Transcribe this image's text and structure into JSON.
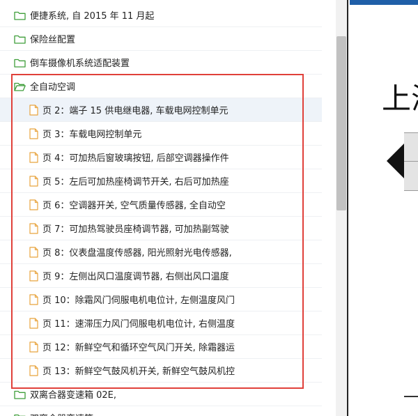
{
  "tree": {
    "rows": [
      {
        "type": "folder",
        "label": "便捷系统, 自 2015 年 11 月起"
      },
      {
        "type": "folder",
        "label": "保险丝配置"
      },
      {
        "type": "folder",
        "label": "倒车摄像机系统适配装置"
      },
      {
        "type": "folder",
        "label": "全自动空调",
        "open": true
      },
      {
        "type": "page",
        "label": "页 2：端子 15 供电继电器, 车载电网控制单元",
        "selected": true
      },
      {
        "type": "page",
        "label": "页 3：车载电网控制单元"
      },
      {
        "type": "page",
        "label": "页 4：可加热后窗玻璃按钮, 后部空调器操作件"
      },
      {
        "type": "page",
        "label": "页 5：左后可加热座椅调节开关, 右后可加热座"
      },
      {
        "type": "page",
        "label": "页 6：空调器开关, 空气质量传感器, 全自动空"
      },
      {
        "type": "page",
        "label": "页 7：可加热驾驶员座椅调节器, 可加热副驾驶"
      },
      {
        "type": "page",
        "label": "页 8：仪表盘温度传感器, 阳光照射光电传感器,"
      },
      {
        "type": "page",
        "label": "页 9：左侧出风口温度调节器, 右侧出风口温度"
      },
      {
        "type": "page",
        "label": "页 10：除霜风门伺服电机电位计, 左侧温度风门"
      },
      {
        "type": "page",
        "label": "页 11：速滞压力风门伺服电机电位计, 右侧温度"
      },
      {
        "type": "page",
        "label": "页 12：新鲜空气和循环空气风门开关, 除霜器运"
      },
      {
        "type": "page",
        "label": "页 13：新鲜空气鼓风机开关, 新鲜空气鼓风机控"
      },
      {
        "type": "folder",
        "label": "双离合器变速箱 02E,"
      },
      {
        "type": "folder",
        "label": "双离合器变速箱"
      }
    ]
  },
  "document": {
    "heading": "上海"
  },
  "colors": {
    "highlight": "#e0403a",
    "folder_icon": "#3f9e3a",
    "page_icon": "#e8a33d",
    "selected_row": "#eef3f9",
    "top_strip": "#1f5fa8"
  },
  "icons": {
    "folder": "folder-icon",
    "folder_open": "folder-open-icon",
    "page": "page-icon",
    "arrow": "arrow-left-icon"
  }
}
